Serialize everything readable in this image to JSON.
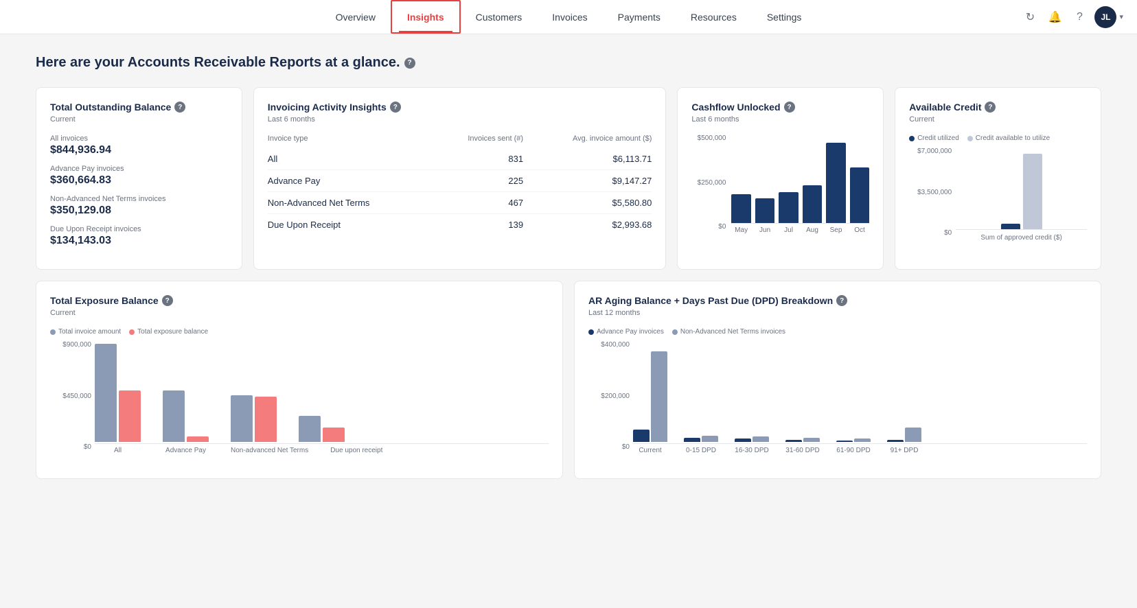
{
  "nav": {
    "items": [
      {
        "label": "Overview",
        "active": false
      },
      {
        "label": "Insights",
        "active": true
      },
      {
        "label": "Customers",
        "active": false
      },
      {
        "label": "Invoices",
        "active": false
      },
      {
        "label": "Payments",
        "active": false
      },
      {
        "label": "Resources",
        "active": false
      },
      {
        "label": "Settings",
        "active": false
      }
    ],
    "avatar_initials": "JL"
  },
  "page": {
    "heading": "Here are your Accounts Receivable Reports at a glance."
  },
  "total_outstanding": {
    "title": "Total Outstanding Balance",
    "subtitle": "Current",
    "all_invoices_label": "All invoices",
    "all_invoices_value": "$844,936.94",
    "advance_pay_label": "Advance Pay invoices",
    "advance_pay_value": "$360,664.83",
    "net_terms_label": "Non-Advanced Net Terms invoices",
    "net_terms_value": "$350,129.08",
    "due_receipt_label": "Due Upon Receipt invoices",
    "due_receipt_value": "$134,143.03"
  },
  "invoicing_activity": {
    "title": "Invoicing Activity Insights",
    "subtitle": "Last 6 months",
    "col_type": "Invoice type",
    "col_sent": "Invoices sent (#)",
    "col_avg": "Avg. invoice amount ($)",
    "rows": [
      {
        "type": "All",
        "sent": "831",
        "avg": "$6,113.71"
      },
      {
        "type": "Advance Pay",
        "sent": "225",
        "avg": "$9,147.27"
      },
      {
        "type": "Non-Advanced Net Terms",
        "sent": "467",
        "avg": "$5,580.80"
      },
      {
        "type": "Due Upon Receipt",
        "sent": "139",
        "avg": "$2,993.68"
      }
    ]
  },
  "cashflow": {
    "title": "Cashflow Unlocked",
    "subtitle": "Last 6 months",
    "y_labels": [
      "$500,000",
      "$250,000",
      "$0"
    ],
    "x_labels": [
      "May",
      "Jun",
      "Jul",
      "Aug",
      "Sep",
      "Oct"
    ],
    "bars": [
      {
        "month": "May",
        "height_pct": 32
      },
      {
        "month": "Jun",
        "height_pct": 28
      },
      {
        "month": "Jul",
        "height_pct": 35
      },
      {
        "month": "Aug",
        "height_pct": 42
      },
      {
        "month": "Sep",
        "height_pct": 90
      },
      {
        "month": "Oct",
        "height_pct": 62
      }
    ]
  },
  "available_credit": {
    "title": "Available Credit",
    "subtitle": "Current",
    "legend": [
      {
        "label": "Credit utilized",
        "color": "#1a3a6b"
      },
      {
        "label": "Credit available to utilize",
        "color": "#c0c8d8"
      }
    ],
    "y_labels": [
      "$7,000,000",
      "$3,500,000",
      "$0"
    ],
    "x_label": "Sum of approved credit ($)",
    "utilized_pct": 8,
    "available_pct": 92
  },
  "total_exposure": {
    "title": "Total Exposure Balance",
    "subtitle": "Current",
    "legend": [
      {
        "label": "Total invoice amount",
        "color": "#8b9ab5"
      },
      {
        "label": "Total exposure balance",
        "color": "#f47c7c"
      }
    ],
    "y_labels": [
      "$900,000",
      "$450,000",
      "$0"
    ],
    "x_labels": [
      "All",
      "Advance Pay",
      "Non-advanced Net Terms",
      "Due upon receipt"
    ],
    "groups": [
      {
        "invoice_pct": 95,
        "exposure_pct": 50
      },
      {
        "invoice_pct": 50,
        "exposure_pct": 5
      },
      {
        "invoice_pct": 45,
        "exposure_pct": 44
      },
      {
        "invoice_pct": 25,
        "exposure_pct": 14
      }
    ]
  },
  "ar_aging": {
    "title": "AR Aging Balance + Days Past Due (DPD) Breakdown",
    "subtitle": "Last 12 months",
    "legend": [
      {
        "label": "Advance Pay invoices",
        "color": "#1a3a6b"
      },
      {
        "label": "Non-Advanced Net Terms invoices",
        "color": "#8b9ab5"
      }
    ],
    "y_labels": [
      "$400,000",
      "$200,000",
      "$0"
    ],
    "x_labels": [
      "Current",
      "0-15 DPD",
      "16-30 DPD",
      "31-60 DPD",
      "61-90 DPD",
      "91+ DPD"
    ],
    "groups": [
      {
        "dark_pct": 12,
        "light_pct": 88
      },
      {
        "dark_pct": 4,
        "light_pct": 6
      },
      {
        "dark_pct": 3,
        "light_pct": 5
      },
      {
        "dark_pct": 2,
        "light_pct": 4
      },
      {
        "dark_pct": 1,
        "light_pct": 3
      },
      {
        "dark_pct": 2,
        "light_pct": 14
      }
    ]
  }
}
